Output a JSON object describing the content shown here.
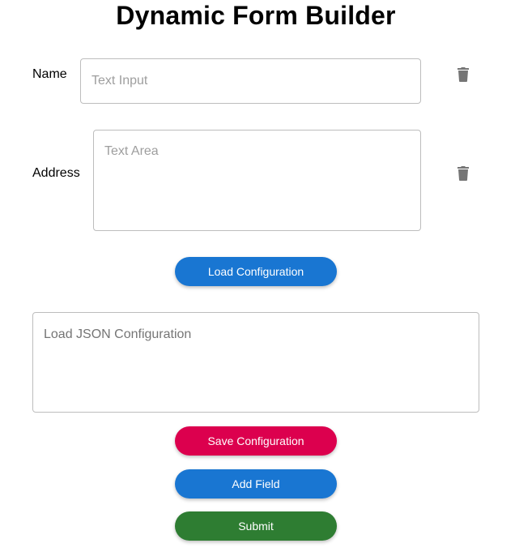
{
  "page": {
    "title": "Dynamic Form Builder"
  },
  "fields": [
    {
      "label": "Name",
      "placeholder": "Text Input",
      "value": "",
      "delete_icon": "trash-icon"
    },
    {
      "label": "Address",
      "placeholder": "Text Area",
      "value": "",
      "delete_icon": "trash-icon"
    }
  ],
  "config": {
    "load_button_label": "Load Configuration",
    "json_placeholder": "Load JSON Configuration",
    "json_value": "",
    "save_button_label": "Save Configuration"
  },
  "actions": {
    "add_field_label": "Add Field",
    "submit_label": "Submit"
  },
  "colors": {
    "primary": "#1976d2",
    "secondary": "#dc004e",
    "success": "#2e7d32",
    "icon": "#757575",
    "border": "#bdbdbd"
  }
}
